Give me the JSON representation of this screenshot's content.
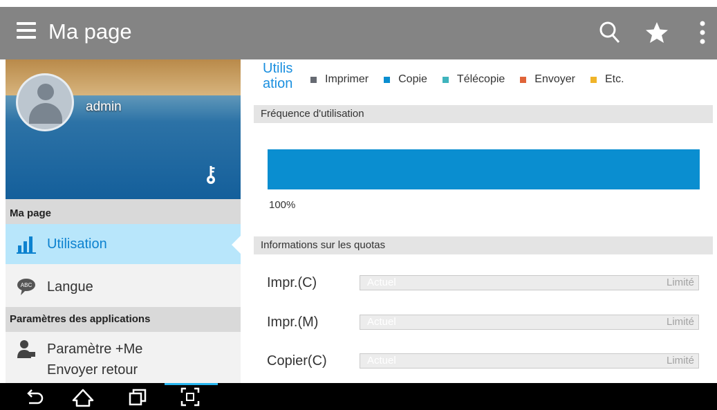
{
  "appbar": {
    "title": "Ma page",
    "icons": [
      "menu-icon",
      "search-icon",
      "star-icon",
      "more-vert-icon"
    ]
  },
  "sidebar": {
    "user": {
      "name": "admin"
    },
    "section1": "Ma page",
    "items": [
      {
        "label": "Utilisation",
        "icon": "bar-chart-icon",
        "active": true
      },
      {
        "label": "Langue",
        "icon": "abc-speech-icon",
        "active": false
      }
    ],
    "section2": "Paramètres des applications",
    "items2": [
      {
        "label": "Paramètre +Me",
        "icon": "user-settings-icon"
      },
      {
        "label": "Envoyer retour",
        "icon": "message-icon"
      }
    ]
  },
  "main": {
    "legend_title": "Utilisation",
    "legend": [
      {
        "label": "Imprimer",
        "color": "#666a72"
      },
      {
        "label": "Copie",
        "color": "#0a8ed0"
      },
      {
        "label": "Télécopie",
        "color": "#3fb4bd"
      },
      {
        "label": "Envoyer",
        "color": "#e06439"
      },
      {
        "label": "Etc.",
        "color": "#f0b429"
      }
    ],
    "frequency_header": "Fréquence d'utilisation",
    "frequency_percent": "100%",
    "quota_header": "Informations sur les quotas",
    "quotas": [
      {
        "label": "Impr.(C)",
        "current": "Actuel",
        "limit": "Limité"
      },
      {
        "label": "Impr.(M)",
        "current": "Actuel",
        "limit": "Limité"
      },
      {
        "label": "Copier(C)",
        "current": "Actuel",
        "limit": "Limité"
      }
    ]
  },
  "navbar": {
    "icons": [
      "back-icon",
      "home-icon",
      "recent-apps-icon",
      "screenshot-icon"
    ]
  }
}
